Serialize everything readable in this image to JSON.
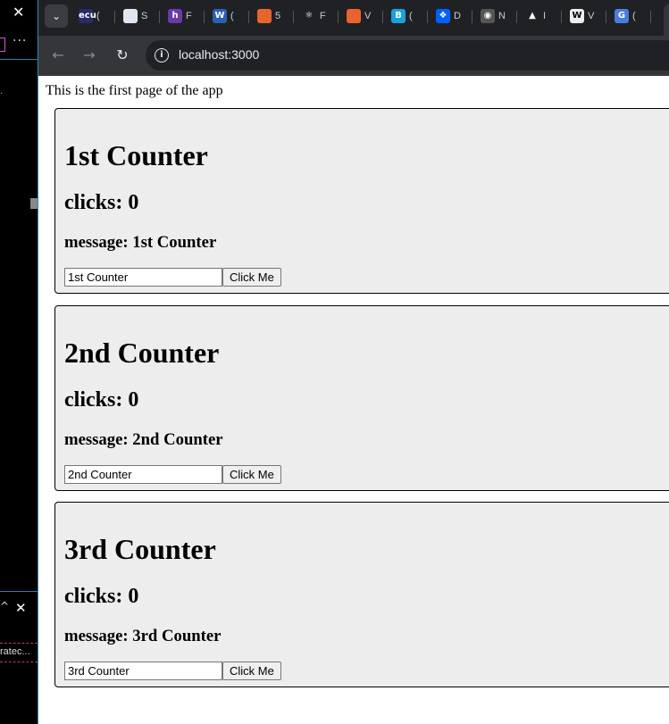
{
  "left_panel": {
    "close_glyph": "✕",
    "more_glyph": "···",
    "tick_glyph": "·",
    "chevron_glyph": "^",
    "close_glyph_2": "✕",
    "truncated_text": "ratec..."
  },
  "browser": {
    "tab_search_glyph": "⌄",
    "tabs": [
      {
        "icon": "ecu-icon",
        "fav_text": "ecu",
        "fav_color": "#2a2a6a",
        "label": "("
      },
      {
        "icon": "page-icon",
        "fav_text": "",
        "fav_color": "#dfe6f0",
        "label": "S"
      },
      {
        "icon": "h-logo-icon",
        "fav_text": "h",
        "fav_color": "#6a3aa8",
        "label": "F"
      },
      {
        "icon": "word-icon",
        "fav_text": "W",
        "fav_color": "#2b5fb3",
        "label": "("
      },
      {
        "icon": "orange-bars-icon",
        "fav_text": "",
        "fav_color": "#e8642c",
        "label": "5"
      },
      {
        "icon": "react-icon",
        "fav_text": "⚛",
        "fav_color": "#202124",
        "label": "F"
      },
      {
        "icon": "orange-bars-icon",
        "fav_text": "",
        "fav_color": "#e8642c",
        "label": "V"
      },
      {
        "icon": "b-icon",
        "fav_text": "B",
        "fav_color": "#1a9fe0",
        "label": "("
      },
      {
        "icon": "dropbox-icon",
        "fav_text": "❖",
        "fav_color": "#0061fe",
        "label": "D"
      },
      {
        "icon": "globe-icon",
        "fav_text": "◉",
        "fav_color": "#555",
        "label": "N"
      },
      {
        "icon": "mit-icon",
        "fav_text": "▲",
        "fav_color": "#202124",
        "label": "I"
      },
      {
        "icon": "wikipedia-icon",
        "fav_text": "W",
        "fav_color": "#eee",
        "label": "V"
      },
      {
        "icon": "translate-icon",
        "fav_text": "G",
        "fav_color": "#4a7be0",
        "label": "("
      }
    ],
    "active_tab_label": "i",
    "back_glyph": "←",
    "forward_glyph": "→",
    "reload_glyph": "↻",
    "info_glyph": "i",
    "url": "localhost:3000"
  },
  "page": {
    "intro": "This is the first page of the app",
    "counters": [
      {
        "title": "1st Counter",
        "clicks_label": "clicks: ",
        "clicks": "0",
        "message_label": "message: ",
        "message": "1st Counter",
        "input_value": "1st Counter",
        "button_label": "Click Me"
      },
      {
        "title": "2nd Counter",
        "clicks_label": "clicks: ",
        "clicks": "0",
        "message_label": "message: ",
        "message": "2nd Counter",
        "input_value": "2nd Counter",
        "button_label": "Click Me"
      },
      {
        "title": "3rd Counter",
        "clicks_label": "clicks: ",
        "clicks": "0",
        "message_label": "message: ",
        "message": "3rd Counter",
        "input_value": "3rd Counter",
        "button_label": "Click Me"
      }
    ]
  }
}
